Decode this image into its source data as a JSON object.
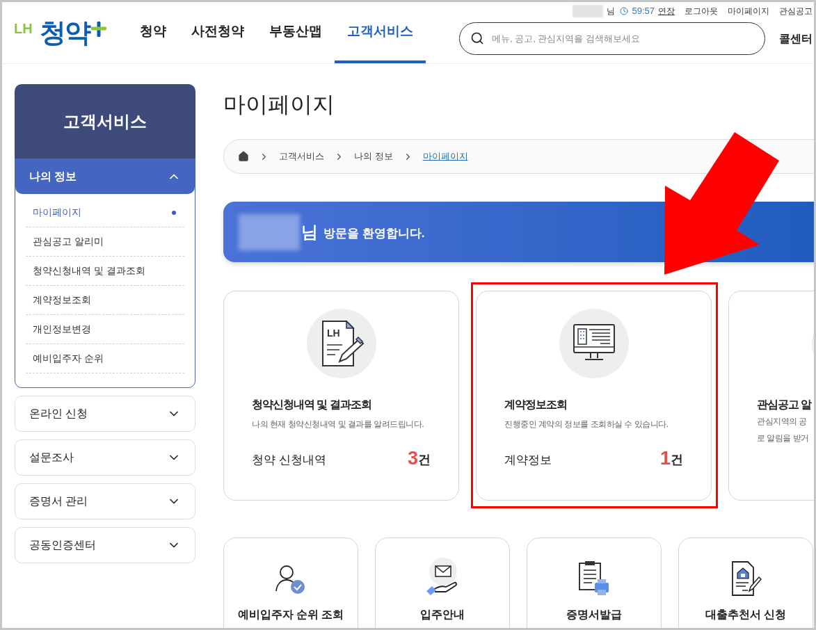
{
  "header": {
    "logo": {
      "prefix": "LH",
      "name": "청약"
    },
    "nav": [
      {
        "label": "청약",
        "selected": false
      },
      {
        "label": "사전청약",
        "selected": false
      },
      {
        "label": "부동산맵",
        "selected": false
      },
      {
        "label": "고객서비스",
        "selected": true
      }
    ],
    "utility": {
      "user_suffix": "님",
      "timer": "59:57",
      "extend": "연장",
      "links": [
        "로그아웃",
        "마이페이지",
        "관심공고"
      ]
    },
    "search": {
      "placeholder": "메뉴, 공고, 관심지역을 검색해보세요"
    },
    "call_center": "콜센터"
  },
  "sidebar": {
    "title": "고객서비스",
    "sections": [
      {
        "label": "나의 정보",
        "expanded": true,
        "items": [
          {
            "label": "마이페이지",
            "selected": true
          },
          {
            "label": "관심공고 알리미",
            "selected": false
          },
          {
            "label": "청약신청내역 및 결과조회",
            "selected": false
          },
          {
            "label": "계약정보조회",
            "selected": false
          },
          {
            "label": "개인정보변경",
            "selected": false
          },
          {
            "label": "예비입주자 순위",
            "selected": false
          }
        ]
      },
      {
        "label": "온라인 신청",
        "expanded": false
      },
      {
        "label": "설문조사",
        "expanded": false
      },
      {
        "label": "증명서 관리",
        "expanded": false
      },
      {
        "label": "공동인증센터",
        "expanded": false
      }
    ]
  },
  "page_title": "마이페이지",
  "breadcrumb": [
    {
      "label": "고객서비스",
      "current": false
    },
    {
      "label": "나의 정보",
      "current": false
    },
    {
      "label": "마이페이지",
      "current": true
    }
  ],
  "welcome": {
    "suffix": "님",
    "message": "방문을 환영합니다."
  },
  "summary_cards": [
    {
      "kind": "application",
      "icon_text": "LH",
      "title": "청약신청내역 및 결과조회",
      "description": "나의 현재 청약신청내역 및 결과를 알려드립니다.",
      "count_label": "청약 신청내역",
      "count": "3",
      "unit": "건"
    },
    {
      "kind": "contract",
      "title": "계약정보조회",
      "description": "진행중인 계약의 정보를 조회하실 수 있습니다.",
      "count_label": "계약정보",
      "count": "1",
      "unit": "건"
    },
    {
      "kind": "alert",
      "title": "관심공고 알",
      "description_lines": [
        "관심지역의 공",
        "로 알림을 받거"
      ]
    }
  ],
  "quick_links": [
    {
      "kind": "ranking",
      "label": "예비입주자 순위 조회"
    },
    {
      "kind": "moving",
      "label": "입주안내"
    },
    {
      "kind": "certificate",
      "label": "증명서발급"
    },
    {
      "kind": "loan",
      "label": "대출추천서 신청"
    }
  ]
}
